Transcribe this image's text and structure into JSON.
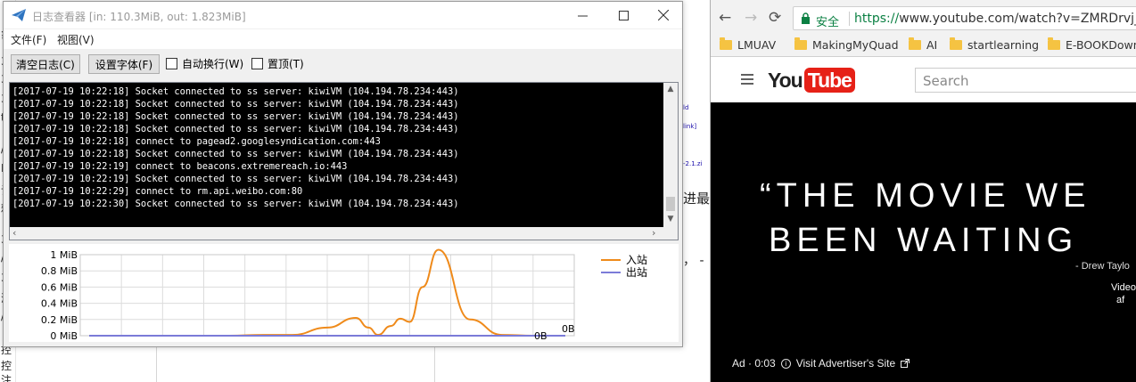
{
  "log_window": {
    "title": "日志查看器 [in: 110.3MiB, out: 1.823MiB]",
    "menu": {
      "file": "文件(F)",
      "view": "视图(V)"
    },
    "toolbar": {
      "clear_label": "清空日志(C)",
      "font_label": "设置字体(F)",
      "wrap_label": "自动换行(W)",
      "ontop_label": "置顶(T)"
    },
    "log_lines": [
      "[2017-07-19 10:22:18] Socket connected to ss server: kiwiVM (104.194.78.234:443)",
      "[2017-07-19 10:22:18] Socket connected to ss server: kiwiVM (104.194.78.234:443)",
      "[2017-07-19 10:22:18] Socket connected to ss server: kiwiVM (104.194.78.234:443)",
      "[2017-07-19 10:22:18] Socket connected to ss server: kiwiVM (104.194.78.234:443)",
      "[2017-07-19 10:22:18] connect to pagead2.googlesyndication.com:443",
      "[2017-07-19 10:22:18] Socket connected to ss server: kiwiVM (104.194.78.234:443)",
      "[2017-07-19 10:22:19] connect to beacons.extremereach.io:443",
      "[2017-07-19 10:22:19] Socket connected to ss server: kiwiVM (104.194.78.234:443)",
      "[2017-07-19 10:22:29] connect to rm.api.weibo.com:80",
      "[2017-07-19 10:22:30] Socket connected to ss server: kiwiVM (104.194.78.234:443)"
    ]
  },
  "chart_data": {
    "type": "line",
    "yticks": [
      "1 MiB",
      "0.8 MiB",
      "0.6 MiB",
      "0.4 MiB",
      "0.2 MiB",
      "0 MiB"
    ],
    "ylim": [
      0,
      1
    ],
    "series": [
      {
        "name": "入站",
        "color": "#ef8a1a",
        "x": [
          0,
          26,
          56,
          88,
          110,
          128,
          150,
          168,
          176,
          182,
          190,
          196,
          202,
          210,
          220,
          240,
          260,
          280,
          300
        ],
        "values": [
          0,
          0,
          0,
          0,
          0.01,
          0.01,
          0.1,
          0.22,
          0.1,
          0.01,
          0.12,
          0.21,
          0.17,
          0.6,
          1.06,
          0.2,
          0.01,
          0,
          0
        ]
      },
      {
        "name": "出站",
        "color": "#7b7bd8",
        "x": [
          0,
          300
        ],
        "values": [
          0,
          0
        ]
      }
    ],
    "right_labels": [
      "0B",
      "0B"
    ]
  },
  "browser": {
    "secure_label": "安全",
    "url_scheme": "https://",
    "url_rest": "www.youtube.com/watch?v=ZMRDrvj_E",
    "bookmarks": [
      "LMUAV",
      "MakingMyQuad",
      "AI",
      "startlearning",
      "E-BOOKDown"
    ],
    "search_placeholder": "Search",
    "logo_you": "You",
    "logo_tube": "Tube",
    "video_line1": "“THE MOVIE WE",
    "video_line2": "BEEN WAITING",
    "video_credit": "- Drew Taylo",
    "video_skip1": "Video",
    "video_skip2": "af",
    "ad_time": "Ad · 0:03",
    "ad_link": "Visit Advertiser's Site"
  },
  "background_doc": {
    "left_chars": [
      "象",
      "3",
      "3",
      "3",
      "t",
      "/",
      "H",
      "试",
      "释",
      "3",
      "/",
      "3",
      "浏",
      "/",
      "控",
      "控",
      "注"
    ],
    "right_snippets": [
      "ld",
      "link]",
      "-2.1.zi",
      "进最新",
      "， -"
    ]
  }
}
